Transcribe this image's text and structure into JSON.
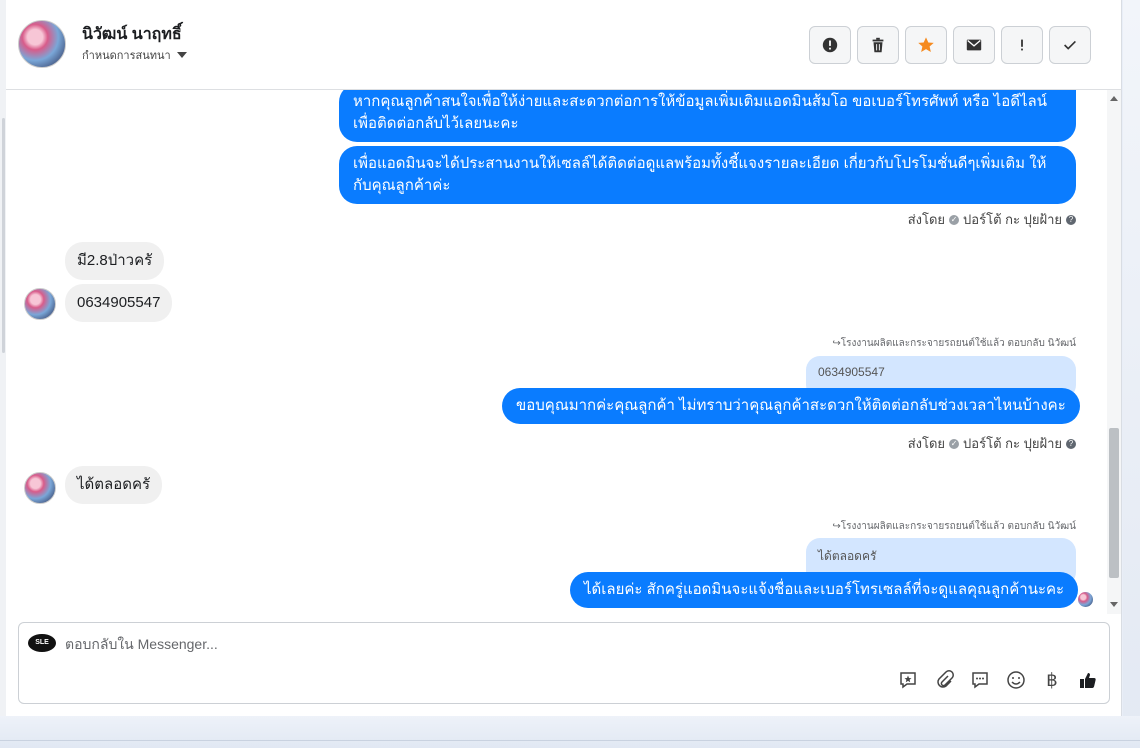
{
  "header": {
    "contact_name": "นิวัฒน์ นาฤทธิ์",
    "assign_label": "กำหนดการสนทนา",
    "actions": [
      "spam",
      "delete",
      "star",
      "mark-unread",
      "important",
      "done"
    ]
  },
  "messages": {
    "out1": "หากคุณลูกค้าสนใจเพื่อให้ง่ายและสะดวกต่อการให้ข้อมูลเพิ่มเติมแอดมินส้มโอ ขอเบอร์โทรศัพท์ หรือ ไอดีไลน์ เพื่อติดต่อกลับไว้เลยนะคะ",
    "out2": "เพื่อแอดมินจะได้ประสานงานให้เซลล์ได้ติดต่อดูแลพร้อมทั้งชี้แจงรายละเอียด เกี่ยวกับโปรโมชั่นดีๆเพิ่มเติม ให้กับคุณลูกค้าค่ะ",
    "sent_by_1": "ส่งโดย",
    "sender_name": "ปอร์โต้ กะ ปุยฝ้าย",
    "in1": "มี2.8ป่าวครั",
    "in2": "0634905547",
    "reply_note_1": "โรงงานผลิตและกระจายรถยนต์ใช้แล้ว ตอบกลับ นิวัฒน์",
    "quote_1": "0634905547",
    "out3": "ขอบคุณมากค่ะคุณลูกค้า ไม่ทราบว่าคุณลูกค้าสะดวกให้ติดต่อกลับช่วงเวลาไหนบ้างคะ",
    "sent_by_2": "ส่งโดย",
    "in3": "ได้ตลอดครั",
    "reply_note_2": "โรงงานผลิตและกระจายรถยนต์ใช้แล้ว ตอบกลับ นิวัฒน์",
    "quote_2": "ได้ตลอดครั",
    "out4": "ได้เลยค่ะ สักครู่แอดมินจะแจ้งชื่อและเบอร์โทรเซลล์ที่จะดูแลคุณลูกค้านะคะ"
  },
  "composer": {
    "placeholder": "ตอบกลับใน Messenger...",
    "page_logo_text": "SLE",
    "tools": [
      "saved-reply-icon",
      "attach-icon",
      "quick-reply-icon",
      "emoji-icon",
      "baht-icon",
      "like-icon"
    ]
  },
  "colors": {
    "outgoing_bubble": "#0a7cff",
    "incoming_bubble": "#f0f0f0",
    "quote_bubble": "#d3e6ff",
    "star": "#f58a1f"
  }
}
